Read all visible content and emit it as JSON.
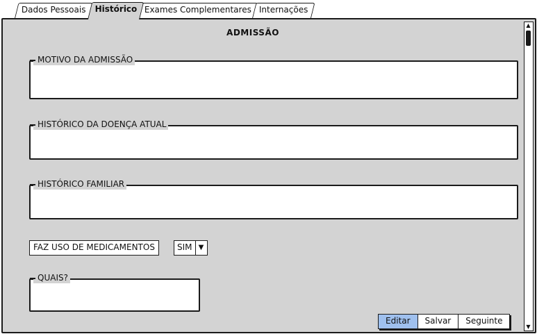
{
  "tabs": [
    {
      "label": "Dados Pessoais",
      "active": false
    },
    {
      "label": "Histórico",
      "active": true
    },
    {
      "label": "Exames Complementares",
      "active": false
    },
    {
      "label": "Internações",
      "active": false
    }
  ],
  "section_title": "ADMISSÃO",
  "fields": {
    "motivo": {
      "label": "MOTIVO DA ADMISSÃO",
      "value": ""
    },
    "doenca_atual": {
      "label": "HISTÓRICO DA DOENÇA ATUAL",
      "value": ""
    },
    "familiar": {
      "label": "HISTÓRICO FAMILIAR",
      "value": ""
    },
    "quais": {
      "label": "QUAIS?",
      "value": ""
    }
  },
  "medicamentos": {
    "label": "FAZ USO DE MEDICAMENTOS",
    "selected": "SIM",
    "arrow_icon": "▼"
  },
  "buttons": {
    "editar": "Editar",
    "salvar": "Salvar",
    "seguinte": "Seguinte"
  },
  "scrollbar": {
    "up_icon": "▲",
    "down_icon": "▼"
  },
  "colors": {
    "panel": "#d3d3d3",
    "selected_button": "#9fc0ee"
  }
}
